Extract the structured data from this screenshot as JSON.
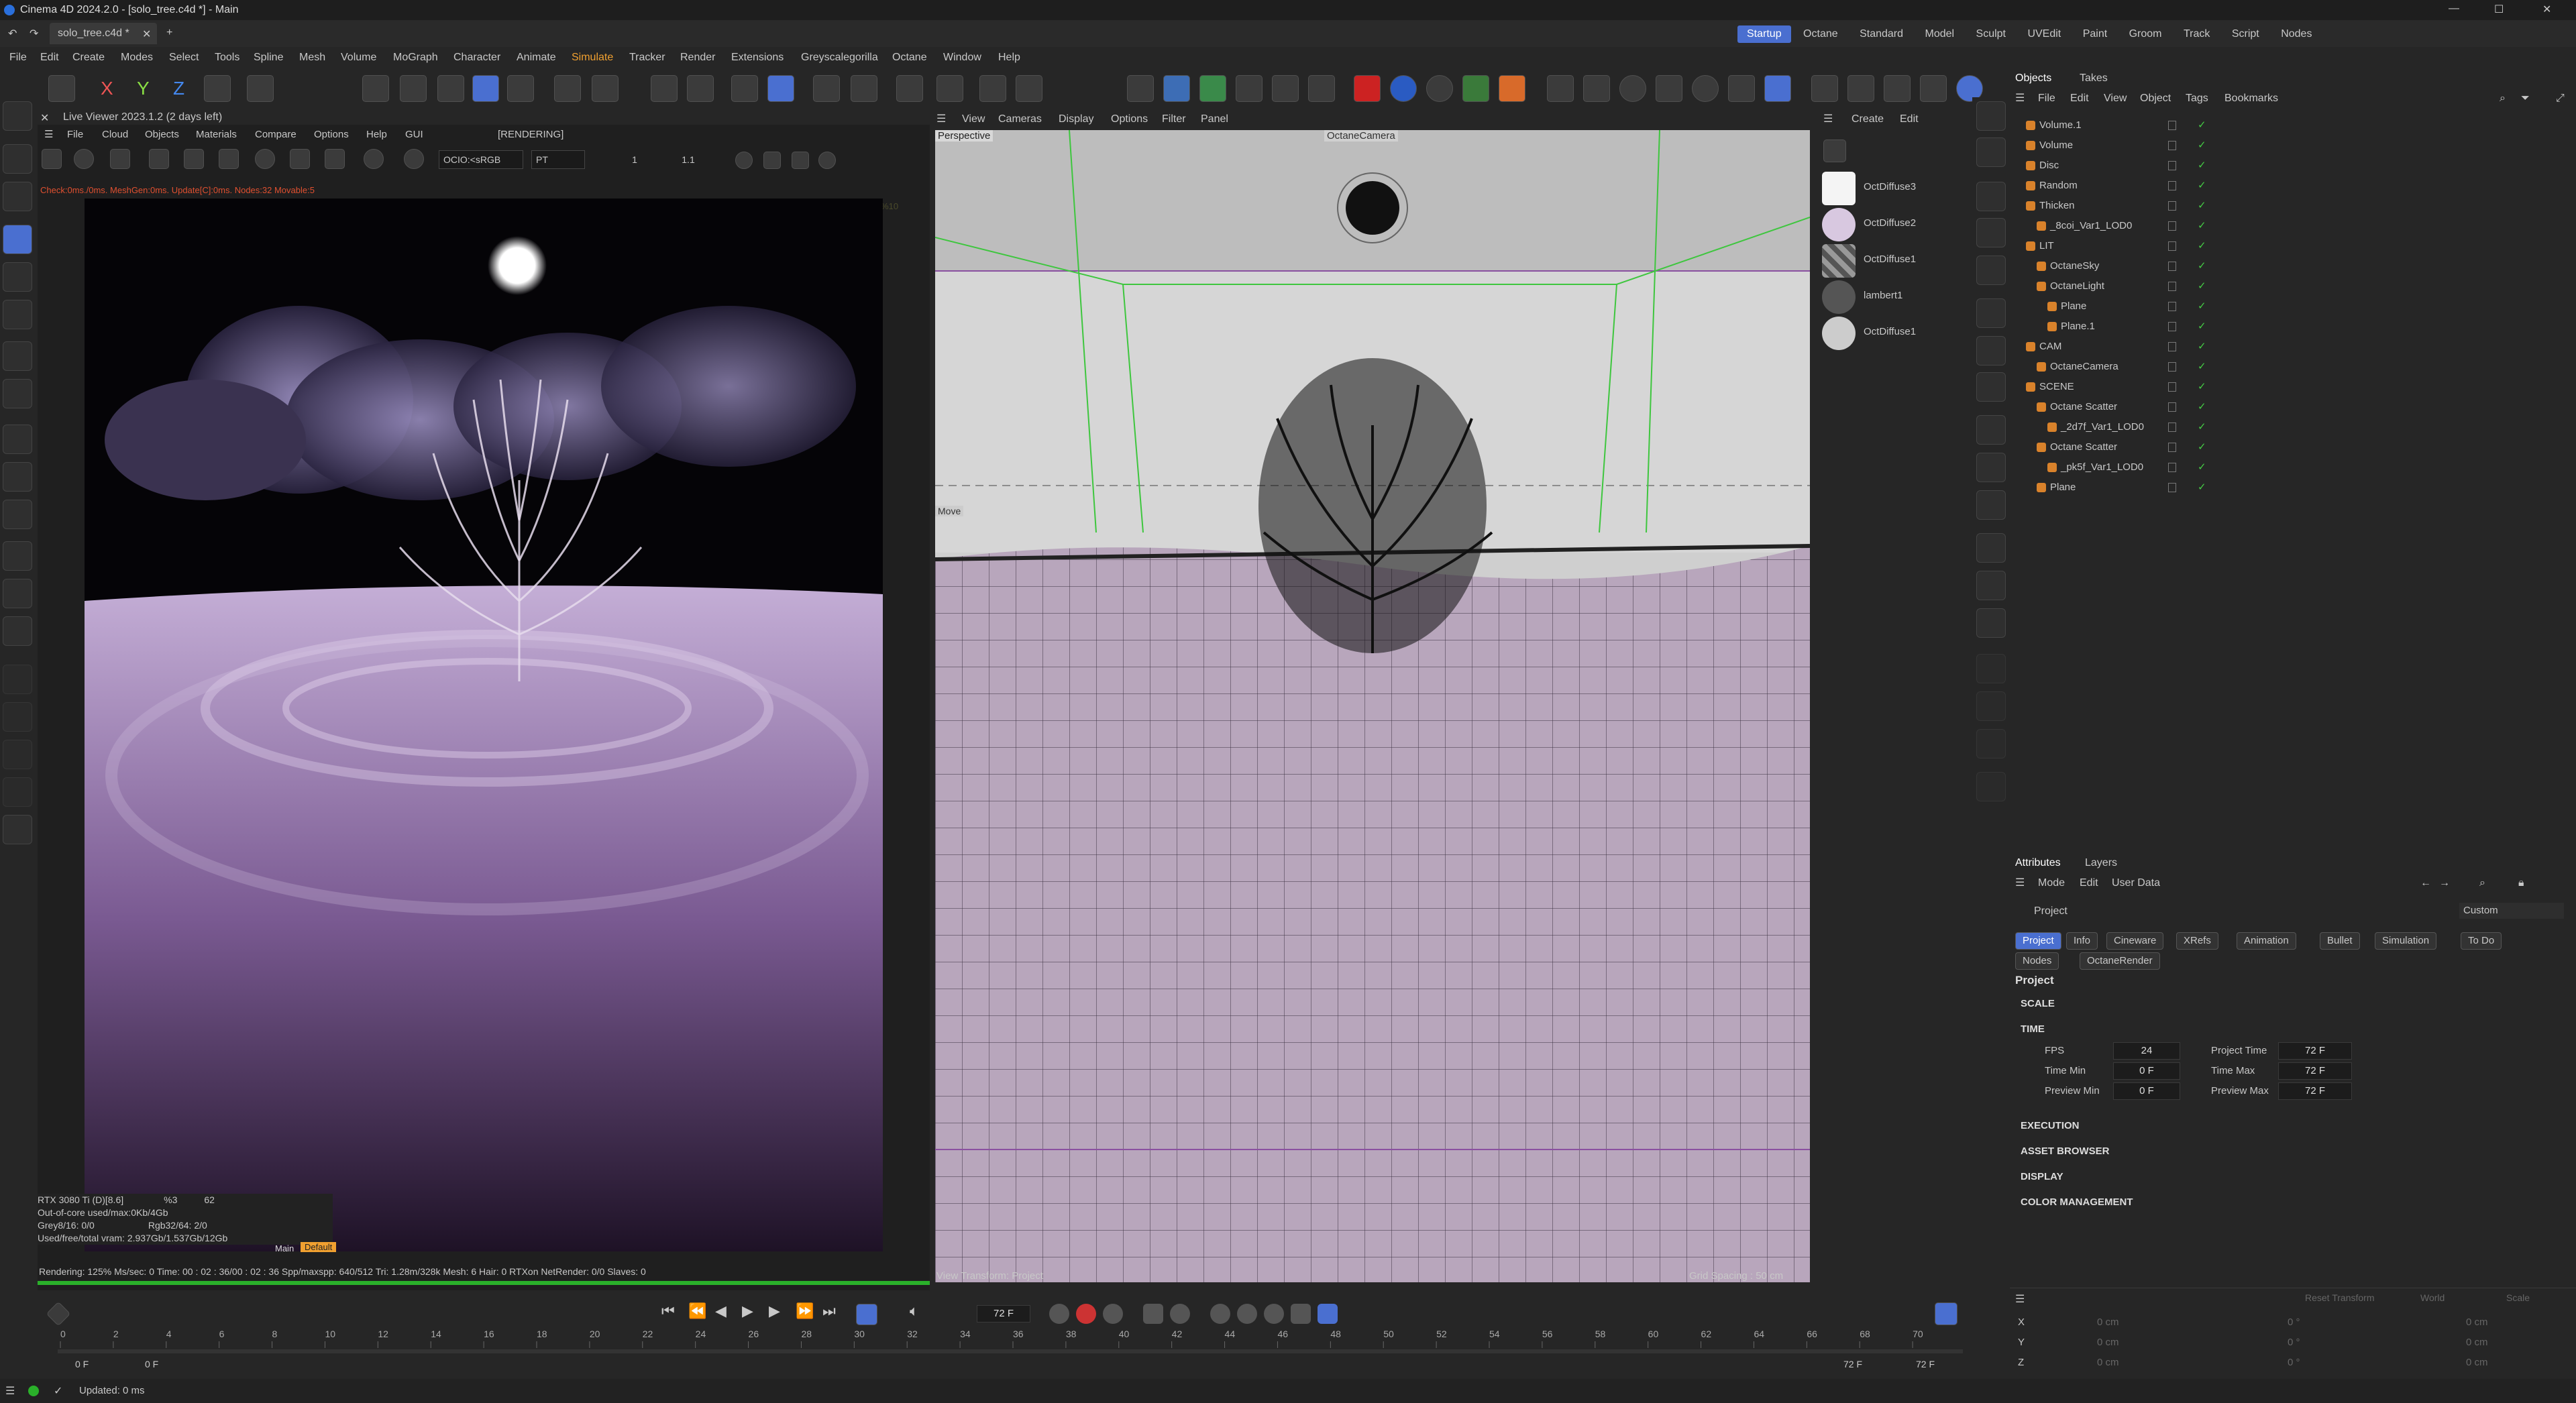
{
  "window": {
    "title": "Cinema 4D 2024.2.0 - [solo_tree.c4d *] - Main",
    "file_tab": "solo_tree.c4d *",
    "plus": "+"
  },
  "menu": [
    "File",
    "Edit",
    "Create",
    "Modes",
    "Select",
    "Tools",
    "Spline",
    "Mesh",
    "Volume",
    "MoGraph",
    "Character",
    "Animate",
    "Simulate",
    "Tracker",
    "Render",
    "Extensions",
    "Greyscalegorilla",
    "Octane",
    "Window",
    "Help"
  ],
  "layouts": [
    "Startup",
    "Octane",
    "Standard",
    "Model",
    "Sculpt",
    "UVEdit",
    "Paint",
    "Groom",
    "Track",
    "Script",
    "Nodes"
  ],
  "axis_labels": {
    "x": "X",
    "y": "Y",
    "z": "Z"
  },
  "live_viewer": {
    "title": "Live Viewer 2023.1.2 (2 days left)",
    "menu": [
      "File",
      "Cloud",
      "Objects",
      "Materials",
      "Compare",
      "Options",
      "Help",
      "GUI"
    ],
    "status": "[RENDERING]",
    "ocio": "OCIO:<sRGB",
    "pt": "PT",
    "val1": "1",
    "val2": "1.1",
    "check": "Check:0ms./0ms. MeshGen:0ms. Update[C]:0ms. Nodes:32 Movable:5",
    "res": "1080*1440 ZOOM:%10",
    "stats": [
      "RTX 3080 Ti (D)[8.6]",
      "%3",
      "62",
      "Out-of-core used/max:0Kb/4Gb",
      "Grey8/16: 0/0",
      "Rgb32/64: 2/0",
      "Used/free/total vram: 2.937Gb/1.537Gb/12Gb"
    ],
    "main_label": "Main",
    "default_label": "Default",
    "bottom": "Rendering: 125% Ms/sec: 0   Time: 00 : 02 : 36/00 : 02 : 36   Spp/maxspp: 640/512   Tri: 1.28m/328k   Mesh: 6  Hair: 0   RTXon   NetRender: 0/0   Slaves: 0"
  },
  "viewport": {
    "menu": [
      "View",
      "Cameras",
      "Display",
      "Options",
      "Filter",
      "Panel"
    ],
    "label": "Perspective",
    "camera": "OctaneCamera",
    "move": "Move",
    "footer_left": "View Transform: Project",
    "footer_right": "Grid Spacing : 50 cm"
  },
  "materials": {
    "menu": [
      "Create",
      "Edit"
    ],
    "items": [
      "OctDiffuse3",
      "OctDiffuse2",
      "OctDiffuse1",
      "lambert1",
      "OctDiffuse1"
    ]
  },
  "objects": {
    "tabs": [
      "Objects",
      "Takes"
    ],
    "menu": [
      "File",
      "Edit",
      "View",
      "Object",
      "Tags",
      "Bookmarks"
    ],
    "items": [
      {
        "name": "Volume.1",
        "indent": 0
      },
      {
        "name": "Volume",
        "indent": 0
      },
      {
        "name": "Disc",
        "indent": 0
      },
      {
        "name": "Random",
        "indent": 0
      },
      {
        "name": "Thicken",
        "indent": 0
      },
      {
        "name": "_8coi_Var1_LOD0",
        "indent": 1
      },
      {
        "name": "LIT",
        "indent": 0
      },
      {
        "name": "OctaneSky",
        "indent": 1
      },
      {
        "name": "OctaneLight",
        "indent": 1
      },
      {
        "name": "Plane",
        "indent": 2
      },
      {
        "name": "Plane.1",
        "indent": 2
      },
      {
        "name": "CAM",
        "indent": 0
      },
      {
        "name": "OctaneCamera",
        "indent": 1
      },
      {
        "name": "SCENE",
        "indent": 0
      },
      {
        "name": "Octane Scatter",
        "indent": 1
      },
      {
        "name": "_2d7f_Var1_LOD0",
        "indent": 2
      },
      {
        "name": "Octane Scatter",
        "indent": 1
      },
      {
        "name": "_pk5f_Var1_LOD0",
        "indent": 2
      },
      {
        "name": "Plane",
        "indent": 1
      }
    ]
  },
  "attributes": {
    "tabs": [
      "Attributes",
      "Layers"
    ],
    "menu": [
      "Mode",
      "Edit",
      "User Data"
    ],
    "crumb": "Project",
    "custom": "Custom",
    "tabs_row1": [
      "Project",
      "Info",
      "Cineware",
      "XRefs",
      "Animation",
      "Bullet",
      "Simulation",
      "To Do"
    ],
    "tabs_row2": [
      "Nodes",
      "OctaneRender"
    ],
    "section": "Project",
    "scale": "SCALE",
    "time": "TIME",
    "fields": [
      {
        "label": "FPS",
        "value": "24"
      },
      {
        "label": "Project Time",
        "value": "72 F"
      },
      {
        "label": "Time Min",
        "value": "0 F"
      },
      {
        "label": "Time Max",
        "value": "72 F"
      },
      {
        "label": "Preview Min",
        "value": "0 F"
      },
      {
        "label": "Preview Max",
        "value": "72 F"
      }
    ],
    "sections": [
      "EXECUTION",
      "ASSET BROWSER",
      "DISPLAY",
      "COLOR MANAGEMENT"
    ]
  },
  "coords": {
    "reset": "Reset Transform",
    "world": "World",
    "scale": "Scale",
    "rows": [
      {
        "axis": "X",
        "a": "0 cm",
        "b": "0 °",
        "c": "0 cm"
      },
      {
        "axis": "Y",
        "a": "0 cm",
        "b": "0 °",
        "c": "0 cm"
      },
      {
        "axis": "Z",
        "a": "0 cm",
        "b": "0 °",
        "c": "0 cm"
      }
    ]
  },
  "timeline": {
    "frame": "72 F",
    "start": "0 F",
    "start2": "0 F",
    "end": "72 F",
    "end2": "72 F",
    "ticks": [
      "0",
      "2",
      "4",
      "6",
      "8",
      "10",
      "12",
      "14",
      "16",
      "18",
      "20",
      "22",
      "24",
      "26",
      "28",
      "30",
      "32",
      "34",
      "36",
      "38",
      "40",
      "42",
      "44",
      "46",
      "48",
      "50",
      "52",
      "54",
      "56",
      "58",
      "60",
      "62",
      "64",
      "66",
      "68",
      "70"
    ]
  },
  "status": {
    "text": "Updated: 0 ms"
  },
  "colors": {
    "accent": "#f0a030",
    "active_layout": "#4a6fd0",
    "viewport_purple": "#b8a6bc"
  }
}
